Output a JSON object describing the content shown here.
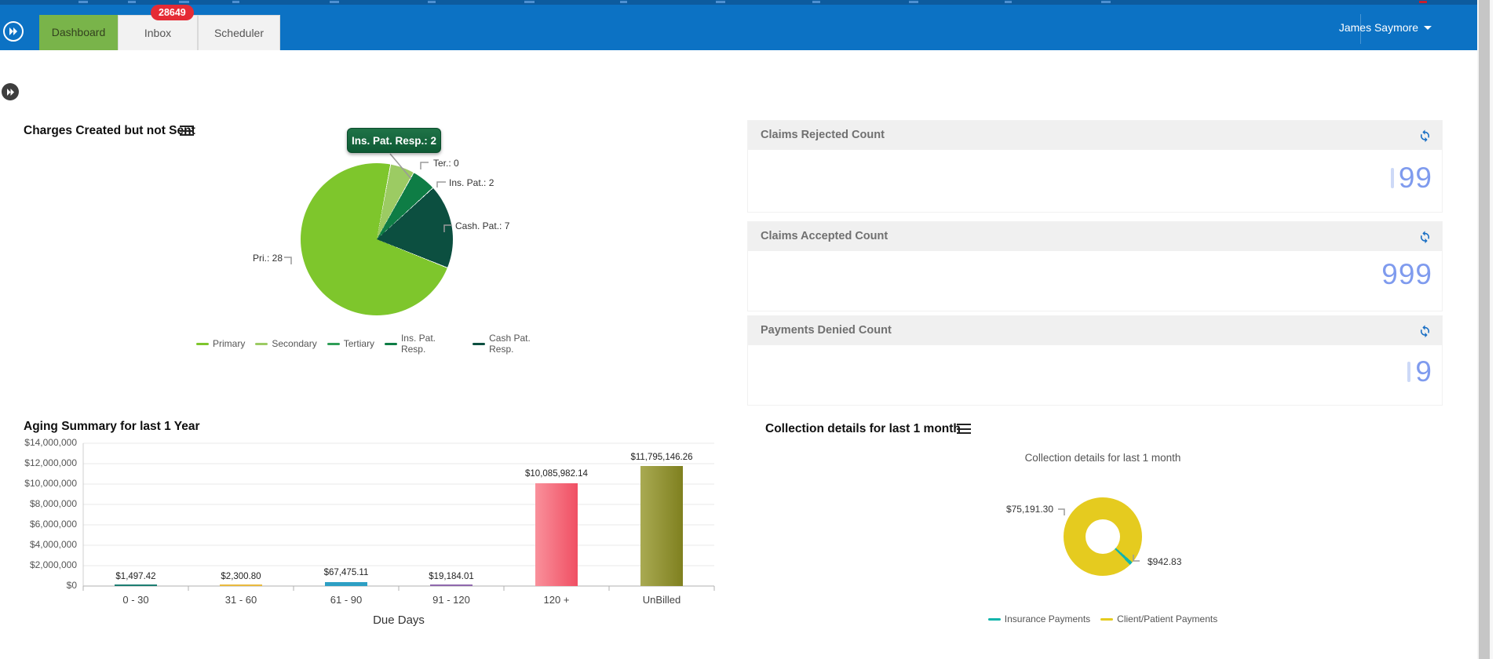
{
  "topbar": {
    "tabs": [
      {
        "label": "Dashboard"
      },
      {
        "label": "Inbox",
        "badge": "28649"
      },
      {
        "label": "Scheduler"
      }
    ],
    "user": "James Saymore"
  },
  "charges": {
    "title": "Charges Created but not Sent",
    "tooltip": "Ins. Pat. Resp.: 2",
    "slice_labels": {
      "pri": "Pri.: 28",
      "ter": "Ter.: 0",
      "ins": "Ins. Pat.: 2",
      "cash": "Cash. Pat.: 7"
    },
    "legend": [
      "Primary",
      "Secondary",
      "Tertiary",
      "Ins. Pat. Resp.",
      "Cash Pat. Resp."
    ],
    "colors": {
      "primary": "#7ec62c",
      "secondary": "#9ccb63",
      "tertiary": "#2f9e57",
      "ins_pat_resp": "#0e7d45",
      "cash_pat_resp": "#0c4f40"
    }
  },
  "kpis": [
    {
      "title": "Claims Rejected Count",
      "value": "99"
    },
    {
      "title": "Claims Accepted Count",
      "value": "999"
    },
    {
      "title": "Payments Denied Count",
      "value": "9"
    }
  ],
  "aging": {
    "title": "Aging Summary for last 1 Year",
    "xlabel": "Due Days",
    "y_labels": [
      "$14,000,000",
      "$12,000,000",
      "$10,000,000",
      "$8,000,000",
      "$6,000,000",
      "$4,000,000",
      "$2,000,000",
      "$0"
    ],
    "categories": [
      "0 - 30",
      "31 - 60",
      "61 - 90",
      "91 - 120",
      "120 +",
      "UnBilled"
    ],
    "value_labels": [
      "$1,497.42",
      "$2,300.80",
      "$67,475.11",
      "$19,184.01",
      "$10,085,982.14",
      "$11,795,146.26"
    ]
  },
  "collection": {
    "title": "Collection details for last 1 month",
    "inner_title": "Collection details for last 1 month",
    "label_client": "$75,191.30",
    "label_insurance": "$942.83",
    "legend": [
      "Insurance Payments",
      "Client/Patient Payments"
    ],
    "colors": {
      "insurance": "#12b4ab",
      "client": "#e5cb1f"
    }
  },
  "chart_data": [
    {
      "type": "pie",
      "title": "Charges Created but not Sent",
      "categories": [
        "Primary",
        "Secondary",
        "Tertiary",
        "Ins. Pat. Resp.",
        "Cash Pat. Resp."
      ],
      "values": [
        28,
        2,
        0,
        2,
        7
      ],
      "legend_position": "bottom",
      "annotations": [
        "Pri.: 28",
        "Ter.: 0",
        "Ins. Pat.: 2",
        "Cash. Pat.: 7",
        "tooltip: Ins. Pat. Resp.: 2"
      ]
    },
    {
      "type": "bar",
      "title": "Aging Summary for last 1 Year",
      "categories": [
        "0 - 30",
        "31 - 60",
        "61 - 90",
        "91 - 120",
        "120 +",
        "UnBilled"
      ],
      "values": [
        1497.42,
        2300.8,
        67475.11,
        19184.01,
        10085982.14,
        11795146.26
      ],
      "xlabel": "Due Days",
      "ylabel": "",
      "ylim": [
        0,
        14000000
      ],
      "grid": true
    },
    {
      "type": "pie",
      "subtype": "donut",
      "title": "Collection details for last 1 month",
      "categories": [
        "Insurance Payments",
        "Client/Patient Payments"
      ],
      "values": [
        942.83,
        75191.3
      ],
      "legend_position": "bottom"
    }
  ]
}
